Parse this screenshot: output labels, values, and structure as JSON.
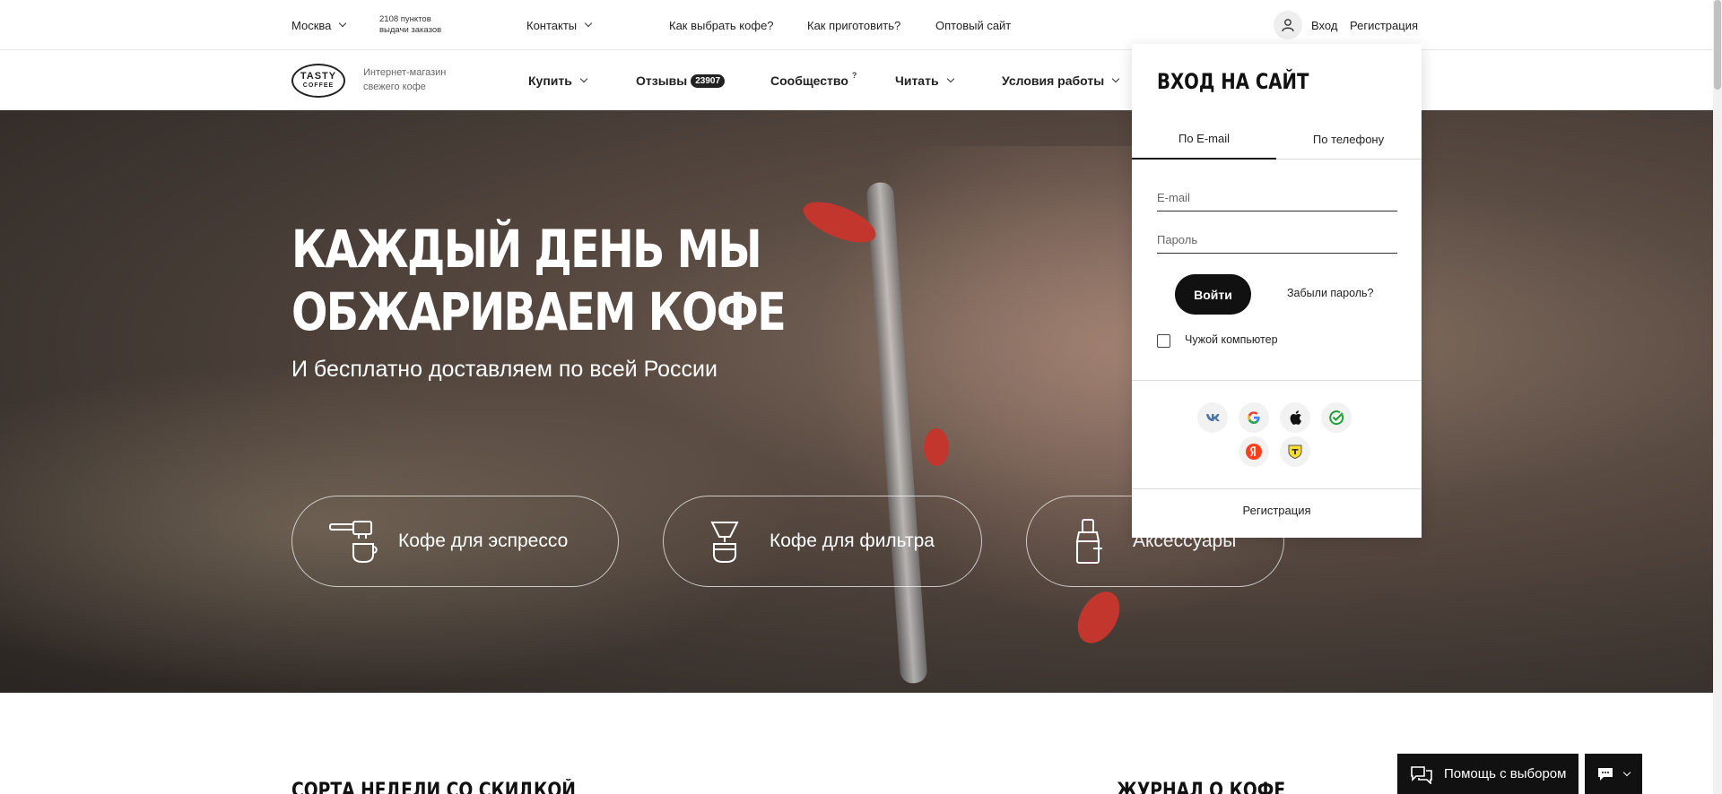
{
  "topbar": {
    "city": "Москва",
    "pickup_line1": "2108 пунктов",
    "pickup_line2": "выдачи заказов",
    "contacts": "Контакты",
    "how_choose": "Как выбрать кофе?",
    "how_brew": "Как приготовить?",
    "wholesale": "Оптовый сайт",
    "login": "Вход",
    "register": "Регистрация"
  },
  "header": {
    "logo_line1": "TASTY",
    "logo_line2": "COFFEE",
    "tagline_line1": "Интернет-магазин",
    "tagline_line2": "свежего кофе",
    "nav": {
      "buy": "Купить",
      "reviews": "Отзывы",
      "reviews_count": "23907",
      "community": "Сообщество",
      "community_mark": "?",
      "read": "Читать",
      "terms": "Условия работы"
    }
  },
  "hero": {
    "title_line1": "КАЖДЫЙ ДЕНЬ МЫ",
    "title_line2": "ОБЖАРИВАЕМ КОФЕ",
    "subtitle": "И бесплатно доставляем по всей России",
    "categories": [
      {
        "label": "Кофе для эспрессо",
        "icon": "espresso-machine-icon"
      },
      {
        "label": "Кофе для фильтра",
        "icon": "filter-dripper-icon"
      },
      {
        "label": "Аксессуары",
        "icon": "grinder-icon"
      }
    ]
  },
  "sections": {
    "weekly": "СОРТА НЕДЕЛИ СО СКИДКОЙ",
    "journal": "ЖУРНАЛ О КОФЕ"
  },
  "help": {
    "label": "Помощь с выбором"
  },
  "login_panel": {
    "title": "ВХОД НА САЙТ",
    "tab_email": "По E-mail",
    "tab_phone": "По телефону",
    "email_placeholder": "E-mail",
    "password_placeholder": "Пароль",
    "submit": "Войти",
    "forgot": "Забыли пароль?",
    "foreign_pc": "Чужой компьютер",
    "register": "Регистрация",
    "socials": [
      "vk-icon",
      "google-icon",
      "apple-icon",
      "sber-icon",
      "yandex-icon",
      "tinkoff-icon"
    ]
  },
  "colors": {
    "accent": "#111111",
    "nail": "#c2362e",
    "vk": "#4a76a8",
    "yandex": "#fc3f1d",
    "sber": "#21a038"
  }
}
